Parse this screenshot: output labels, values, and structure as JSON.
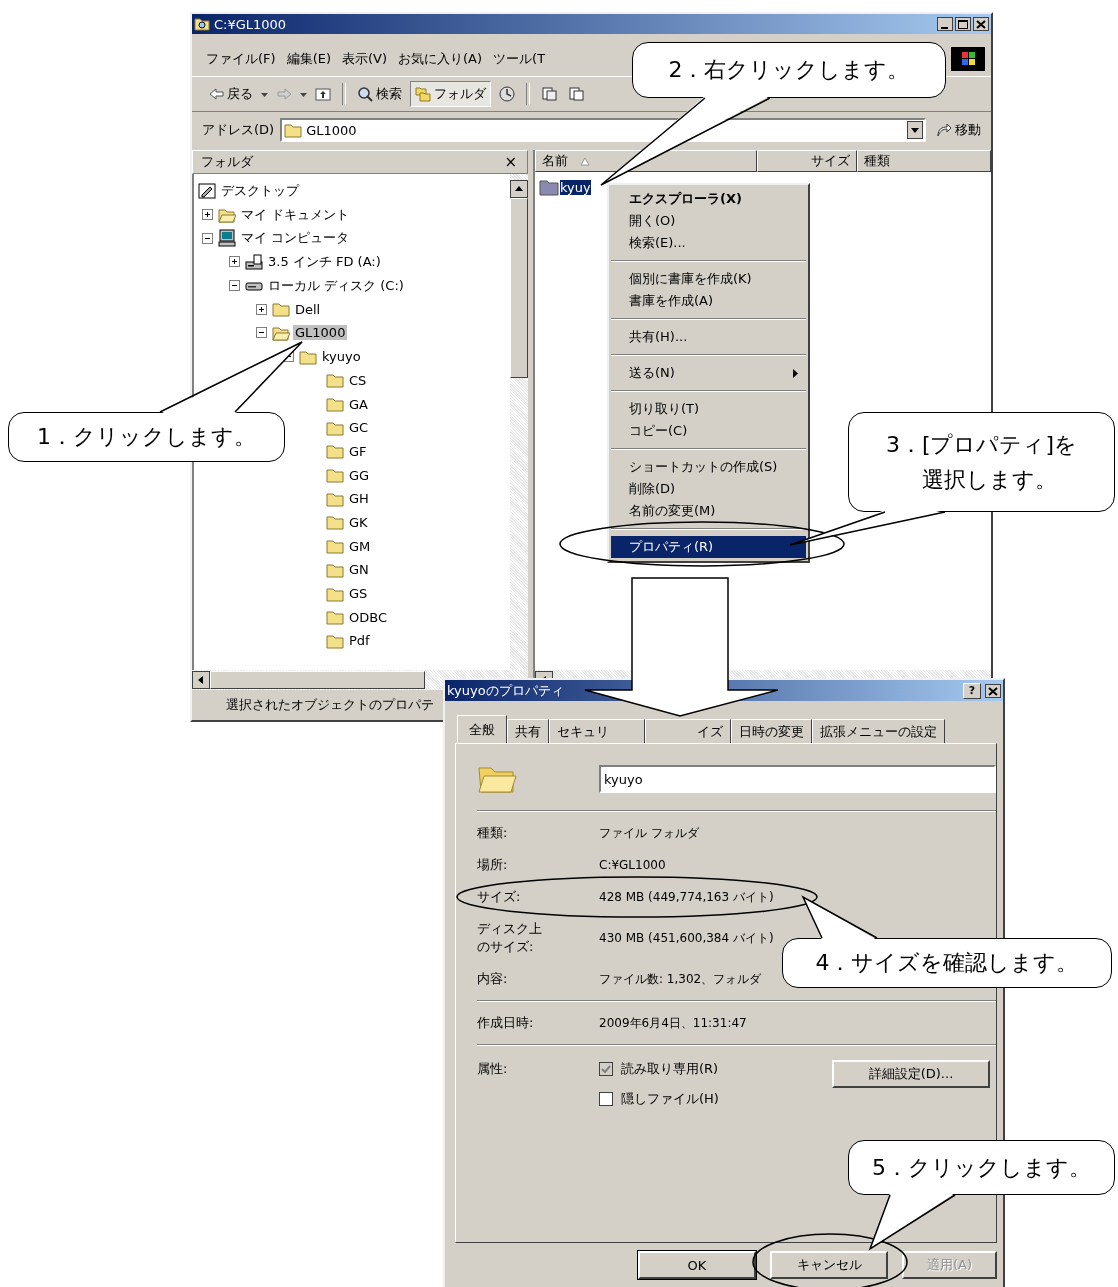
{
  "explorer": {
    "title": "C:¥GL1000",
    "menu": [
      "ファイル(F)",
      "編集(E)",
      "表示(V)",
      "お気に入り(A)",
      "ツール(T"
    ],
    "toolbar": [
      {
        "kind": "back",
        "label": "戻る",
        "pressed": false
      },
      {
        "kind": "forward",
        "pressed": false
      },
      {
        "kind": "up",
        "pressed": false
      },
      {
        "kind": "separator"
      },
      {
        "kind": "search",
        "label": "検索",
        "pressed": false
      },
      {
        "kind": "folders",
        "label": "フォルダ",
        "pressed": true
      },
      {
        "kind": "history",
        "pressed": false
      },
      {
        "kind": "separator"
      },
      {
        "kind": "move",
        "pressed": false
      },
      {
        "kind": "copy",
        "pressed": false
      }
    ],
    "address": {
      "label": "アドレス(D)",
      "value": "GL1000",
      "go": "移動"
    },
    "folder_pane": {
      "title": "フォルダ",
      "close": "×",
      "tree": [
        {
          "label": "デスクトップ",
          "kind": "desktop",
          "selected": false,
          "children": [
            {
              "label": "マイ ドキュメント",
              "kind": "documents",
              "expanded": false,
              "selected": false
            },
            {
              "label": "マイ コンピュータ",
              "kind": "computer",
              "expanded": true,
              "selected": false,
              "children": [
                {
                  "label": "3.5 インチ FD (A:)",
                  "kind": "floppy",
                  "expanded": false,
                  "selected": false
                },
                {
                  "label": "ローカル ディスク (C:)",
                  "kind": "drive",
                  "expanded": true,
                  "selected": false,
                  "children": [
                    {
                      "label": "Dell",
                      "kind": "folder",
                      "expanded": false,
                      "selected": false
                    },
                    {
                      "label": "GL1000",
                      "kind": "open-folder",
                      "expanded": true,
                      "selected": true,
                      "children": [
                        {
                          "label": "kyuyo",
                          "kind": "folder",
                          "expanded": true,
                          "selected": false,
                          "children": [
                            {
                              "label": "CS",
                              "kind": "folder",
                              "selected": false
                            },
                            {
                              "label": "GA",
                              "kind": "folder",
                              "selected": false
                            },
                            {
                              "label": "GC",
                              "kind": "folder",
                              "selected": false
                            },
                            {
                              "label": "GF",
                              "kind": "folder",
                              "selected": false
                            },
                            {
                              "label": "GG",
                              "kind": "folder",
                              "selected": false
                            },
                            {
                              "label": "GH",
                              "kind": "folder",
                              "selected": false
                            },
                            {
                              "label": "GK",
                              "kind": "folder",
                              "selected": false
                            },
                            {
                              "label": "GM",
                              "kind": "folder",
                              "selected": false
                            },
                            {
                              "label": "GN",
                              "kind": "folder",
                              "selected": false
                            },
                            {
                              "label": "GS",
                              "kind": "folder",
                              "selected": false
                            },
                            {
                              "label": "ODBC",
                              "kind": "folder",
                              "selected": false
                            },
                            {
                              "label": "Pdf",
                              "kind": "folder",
                              "selected": false
                            }
                          ]
                        }
                      ]
                    }
                  ]
                }
              ]
            }
          ]
        }
      ]
    },
    "list": {
      "columns": [
        "名前",
        "サイズ",
        "種類"
      ],
      "items": [
        {
          "name": "kyuy",
          "selected": true
        }
      ]
    },
    "status_bar": "選択されたオブジェクトのプロパテ"
  },
  "context_menu": {
    "groups": [
      [
        {
          "label": "エクスプローラ(X)",
          "default": true,
          "submenu": false,
          "selected": false
        },
        {
          "label": "開く(O)",
          "default": false,
          "submenu": false,
          "selected": false
        },
        {
          "label": "検索(E)...",
          "default": false,
          "submenu": false,
          "selected": false
        }
      ],
      [
        {
          "label": "個別に書庫を作成(K)",
          "default": false,
          "submenu": false,
          "selected": false
        },
        {
          "label": "書庫を作成(A)",
          "default": false,
          "submenu": false,
          "selected": false
        }
      ],
      [
        {
          "label": "共有(H)...",
          "default": false,
          "submenu": false,
          "selected": false
        }
      ],
      [
        {
          "label": "送る(N)",
          "default": false,
          "submenu": true,
          "selected": false
        }
      ],
      [
        {
          "label": "切り取り(T)",
          "default": false,
          "submenu": false,
          "selected": false
        },
        {
          "label": "コピー(C)",
          "default": false,
          "submenu": false,
          "selected": false
        }
      ],
      [
        {
          "label": "ショートカットの作成(S)",
          "default": false,
          "submenu": false,
          "selected": false
        },
        {
          "label": "削除(D)",
          "default": false,
          "submenu": false,
          "selected": false
        },
        {
          "label": "名前の変更(M)",
          "default": false,
          "submenu": false,
          "selected": false
        }
      ],
      [
        {
          "label": "プロパティ(R)",
          "default": false,
          "submenu": false,
          "selected": true
        }
      ]
    ]
  },
  "dialog": {
    "title": "kyuyoのプロパティ",
    "help": "?",
    "tabs": [
      {
        "label": "全般",
        "selected": true
      },
      {
        "label": "共有",
        "selected": false
      },
      {
        "label": "セキュリ",
        "selected": false
      },
      {
        "label": "イズ",
        "selected": false
      },
      {
        "label": "日時の変更",
        "selected": false
      },
      {
        "label": "拡張メニューの設定",
        "selected": false
      }
    ],
    "name_field": {
      "value": "kyuyo"
    },
    "sections": [
      [
        {
          "label": "種類:",
          "value": "ファイル フォルダ"
        },
        {
          "label": "場所:",
          "value": "C:¥GL1000"
        },
        {
          "label": "サイズ:",
          "value": "428 MB (449,774,163 バイト)"
        },
        {
          "label": "ディスク上のサイズ:",
          "value": "430 MB (451,600,384 バイト)"
        },
        {
          "label": "内容:",
          "value": "ファイル数: 1,302、フォルダ"
        }
      ],
      [
        {
          "label": "作成日時:",
          "value": "2009年6月4日、11:31:47"
        }
      ]
    ],
    "attributes": {
      "label": "属性:",
      "checkboxes": [
        {
          "label": "読み取り専用(R)",
          "checked": true,
          "greyed": true
        },
        {
          "label": "隠しファイル(H)",
          "checked": false,
          "greyed": false
        }
      ],
      "advanced": "詳細設定(D)..."
    },
    "buttons": [
      {
        "label": "OK",
        "default": true,
        "disabled": false
      },
      {
        "label": "キャンセル",
        "default": false,
        "disabled": false
      },
      {
        "label": "適用(A)",
        "default": false,
        "disabled": true
      }
    ]
  },
  "callouts": [
    {
      "lines": [
        "1．クリックします。"
      ]
    },
    {
      "lines": [
        "2．右クリックします。"
      ]
    },
    {
      "lines": [
        "3．[プロパティ]を",
        "選択します。"
      ]
    },
    {
      "lines": [
        "4．サイズを確認します。"
      ]
    },
    {
      "lines": [
        "5．クリックします。"
      ]
    }
  ]
}
